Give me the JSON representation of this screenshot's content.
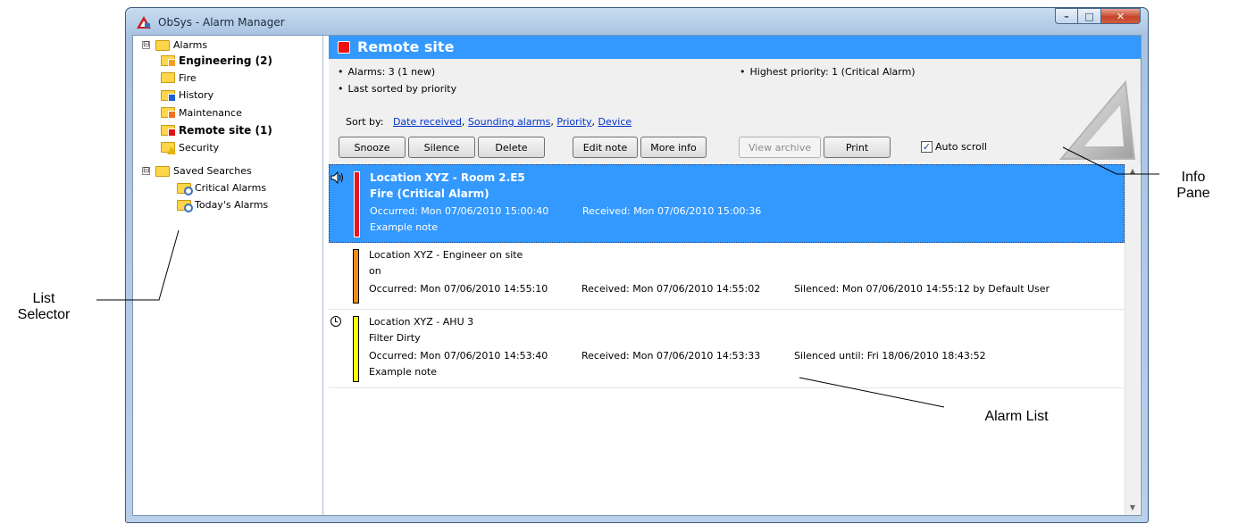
{
  "window": {
    "title": "ObSys - Alarm Manager",
    "app_icon": "obsys-logo-icon",
    "controls": {
      "minimize": "–",
      "maximize": "□",
      "close": "✕"
    }
  },
  "tree": {
    "root_alarms": {
      "label": "Alarms",
      "expander": "⊟"
    },
    "items": [
      {
        "label": "Engineering (2)",
        "bold": true,
        "icon": "folder-alarm-icon",
        "badge_color": "#f0a020"
      },
      {
        "label": "Fire",
        "bold": false,
        "icon": "folder-icon"
      },
      {
        "label": "History",
        "bold": false,
        "icon": "folder-history-icon",
        "badge_color": "#2060d0"
      },
      {
        "label": "Maintenance",
        "bold": false,
        "icon": "folder-alarm-icon",
        "badge_color": "#f07020"
      },
      {
        "label": "Remote site (1)",
        "bold": true,
        "icon": "folder-alarm-icon",
        "badge_color": "#e01010"
      },
      {
        "label": "Security",
        "bold": false,
        "icon": "folder-warning-icon"
      }
    ],
    "root_saved": {
      "label": "Saved Searches",
      "expander": "⊟"
    },
    "saved": [
      {
        "label": "Critical Alarms",
        "icon": "folder-search-icon"
      },
      {
        "label": "Today's Alarms",
        "icon": "folder-search-icon"
      }
    ]
  },
  "header": {
    "title": "Remote site",
    "color": "#3399ff",
    "status_color": "#ee1010"
  },
  "info": {
    "alarms": "Alarms: 3 (1 new)",
    "last_sorted": "Last sorted by priority",
    "highest_priority": "Highest priority: 1 (Critical Alarm)",
    "sort_by_label": "Sort by:",
    "sort_links": [
      "Date received",
      "Sounding alarms",
      "Priority",
      "Device"
    ],
    "sort_sep": ", "
  },
  "toolbar": {
    "snooze": "Snooze",
    "silence": "Silence",
    "delete": "Delete",
    "edit_note": "Edit note",
    "more_info": "More info",
    "view_archive": "View archive",
    "print": "Print",
    "auto_scroll": "Auto scroll",
    "auto_scroll_checked": true,
    "check_mark": "✓"
  },
  "alarms": [
    {
      "location": "Location XYZ - Room 2.E5",
      "state": "Fire  (Critical Alarm)",
      "occurred": "Occurred: Mon 07/06/2010 15:00:40",
      "received": "Received: Mon 07/06/2010 15:00:36",
      "silenced": "",
      "note": "Example note",
      "priority_color": "#e8141e",
      "icon": "speaker-icon",
      "selected": true
    },
    {
      "location": "Location XYZ - Engineer on site",
      "state": "on",
      "occurred": "Occurred: Mon 07/06/2010 14:55:10",
      "received": "Received: Mon 07/06/2010 14:55:02",
      "silenced": "Silenced: Mon 07/06/2010 14:55:12 by Default User",
      "note": "",
      "priority_color": "#f08c14",
      "icon": "",
      "selected": false
    },
    {
      "location": "Location XYZ - AHU 3",
      "state": "Filter Dirty",
      "occurred": "Occurred: Mon 07/06/2010 14:53:40",
      "received": "Received: Mon 07/06/2010 14:53:33",
      "silenced": "Silenced until: Fri 18/06/2010 18:43:52",
      "note": "Example note",
      "priority_color": "#ffff00",
      "icon": "clock-icon",
      "selected": false
    }
  ],
  "callouts": {
    "info_pane": [
      "Info",
      "Pane"
    ],
    "list_selector": [
      "List",
      "Selector"
    ],
    "alarm_list": "Alarm List"
  }
}
